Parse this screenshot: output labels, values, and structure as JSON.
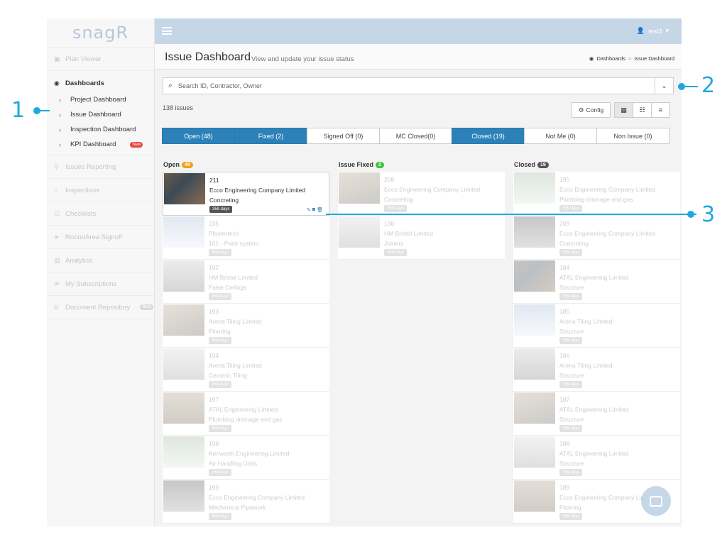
{
  "app": {
    "logo": "snagR"
  },
  "sidebar": {
    "items": [
      {
        "label": "Plan Viewer",
        "icon": "image-icon"
      },
      {
        "label": "Dashboards",
        "icon": "dashboard-icon",
        "children": [
          "Project Dashboard",
          "Issue Dashboard",
          "Inspection Dashboard",
          "KPI Dashboard"
        ],
        "kpi_badge": "New"
      },
      {
        "label": "Issues Reporting",
        "icon": "map-marker-icon"
      },
      {
        "label": "Inspections",
        "icon": "search-icon"
      },
      {
        "label": "Checklists",
        "icon": "checkbox-icon"
      },
      {
        "label": "Room/Area Signoff",
        "icon": "send-icon"
      },
      {
        "label": "Analytics",
        "icon": "bar-chart-icon"
      },
      {
        "label": "My Subscriptions",
        "icon": "envelope-icon"
      },
      {
        "label": "Document Repository",
        "icon": "copy-icon",
        "badge": "Beta"
      }
    ]
  },
  "topbar": {
    "user": "test3"
  },
  "header": {
    "title": "Issue Dashboard",
    "subtitle": "View and update your issue status",
    "breadcrumb": [
      "Dashboards",
      "Issue Dashboard"
    ]
  },
  "search": {
    "placeholder": "Search ID, Contractor, Owner"
  },
  "issue_count": "138 issues",
  "config_label": "Config",
  "tabs": [
    {
      "label": "Open (48)",
      "active": true
    },
    {
      "label": "Fixed (2)",
      "active": true
    },
    {
      "label": "Signed Off (0)",
      "active": false
    },
    {
      "label": "MC Closed(0)",
      "active": false
    },
    {
      "label": "Closed (19)",
      "active": true
    },
    {
      "label": "Not Me (0)",
      "active": false
    },
    {
      "label": "Non Issue (0)",
      "active": false
    }
  ],
  "columns": [
    {
      "title": "Open",
      "count": "48",
      "badge_color": "#f0a020",
      "cards": [
        {
          "id": "211",
          "company": "Ecco Engineering Company Limited",
          "trade": "Concreting",
          "days": "359 days",
          "focus": true
        },
        {
          "id": "235",
          "company": "Plastertech",
          "trade": "161 - Paint system",
          "days": "359 days"
        },
        {
          "id": "192",
          "company": "HM Bristol Limited",
          "trade": "False Ceilings",
          "days": "359 days"
        },
        {
          "id": "193",
          "company": "Arena Tiling Limited",
          "trade": "Flooring",
          "days": "359 days"
        },
        {
          "id": "194",
          "company": "Arena Tiling Limited",
          "trade": "Ceramic Tiling",
          "days": "359 days"
        },
        {
          "id": "197",
          "company": "ATAL Engineering Limited",
          "trade": "Plumbing drainage and gas",
          "days": "359 days"
        },
        {
          "id": "198",
          "company": "Kenworth Engineering Limited",
          "trade": "Air Handling Units",
          "days": "359 days"
        },
        {
          "id": "199",
          "company": "Ecco Engineering Company Limited",
          "trade": "Mechanical Pipework",
          "days": "359 days"
        }
      ]
    },
    {
      "title": "Issue Fixed",
      "count": "2",
      "badge_color": "#3cc43c",
      "cards": [
        {
          "id": "208",
          "company": "Ecco Engineering Company Limited",
          "trade": "Concreting",
          "days": "359 days"
        },
        {
          "id": "190",
          "company": "HM Bristol Limited",
          "trade": "Joinery",
          "days": "359 days"
        }
      ]
    },
    {
      "title": "Closed",
      "count": "19",
      "badge_color": "#555555",
      "cards": [
        {
          "id": "195",
          "company": "Ecco Engineering Company Limited",
          "trade": "Plumbing drainage and gas",
          "days": "359 days"
        },
        {
          "id": "209",
          "company": "Ecco Engineering Company Limited",
          "trade": "Concreting",
          "days": "359 days"
        },
        {
          "id": "184",
          "company": "ATAL Engineering Limited",
          "trade": "Structure",
          "days": "359 days"
        },
        {
          "id": "185",
          "company": "Arena Tiling Limited",
          "trade": "Structure",
          "days": "359 days"
        },
        {
          "id": "186",
          "company": "Arena Tiling Limited",
          "trade": "Structure",
          "days": "359 days"
        },
        {
          "id": "187",
          "company": "ATAL Engineering Limited",
          "trade": "Structure",
          "days": "359 days"
        },
        {
          "id": "188",
          "company": "ATAL Engineering Limited",
          "trade": "Structure",
          "days": "359 days"
        },
        {
          "id": "189",
          "company": "Ecco Engineering Company Limited",
          "trade": "Flooring",
          "days": "359 days"
        }
      ]
    }
  ],
  "annotations": [
    "1",
    "2",
    "3"
  ],
  "colors": {
    "accent": "#2c81b8",
    "annotation": "#1ea9dc",
    "topbar": "#c5d6e6"
  }
}
